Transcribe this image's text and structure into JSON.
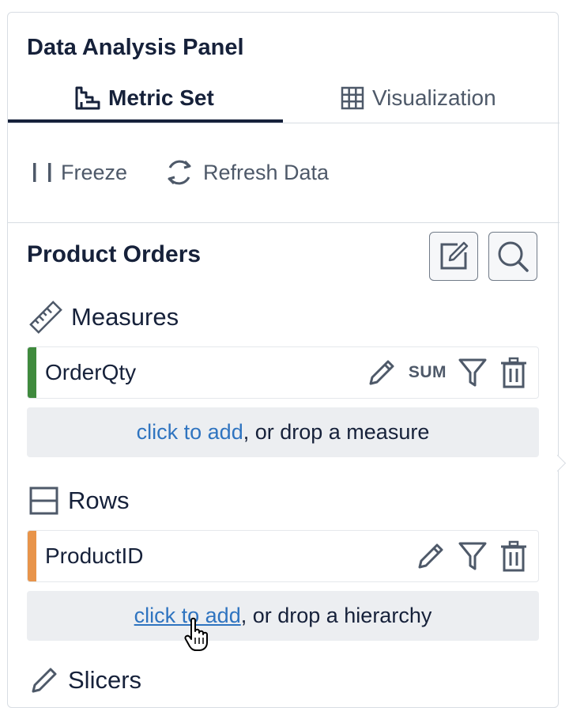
{
  "panel": {
    "title": "Data Analysis Panel",
    "tabs": [
      {
        "label": "Metric Set",
        "icon": "metric-set-icon",
        "active": true
      },
      {
        "label": "Visualization",
        "icon": "grid-icon",
        "active": false
      }
    ],
    "toolbar": {
      "freeze_label": "Freeze",
      "refresh_label": "Refresh Data"
    },
    "section": {
      "title": "Product Orders",
      "buttons": [
        "edit-icon",
        "search-icon"
      ]
    },
    "measures": {
      "label": "Measures",
      "items": [
        {
          "name": "OrderQty",
          "aggregate": "SUM",
          "accent_color": "#3f8a3d"
        }
      ],
      "dropzone": {
        "link": "click to add",
        "rest": ", or drop a measure"
      }
    },
    "rows": {
      "label": "Rows",
      "items": [
        {
          "name": "ProductID",
          "accent_color": "#e8944a"
        }
      ],
      "dropzone": {
        "link": "click to add",
        "rest": ", or drop a hierarchy"
      }
    },
    "slicers": {
      "label": "Slicers"
    }
  },
  "colors": {
    "primary_text": "#16213a",
    "secondary_text": "#4e5969",
    "link": "#2f74c0",
    "measure_accent": "#3f8a3d",
    "row_accent": "#e8944a"
  }
}
